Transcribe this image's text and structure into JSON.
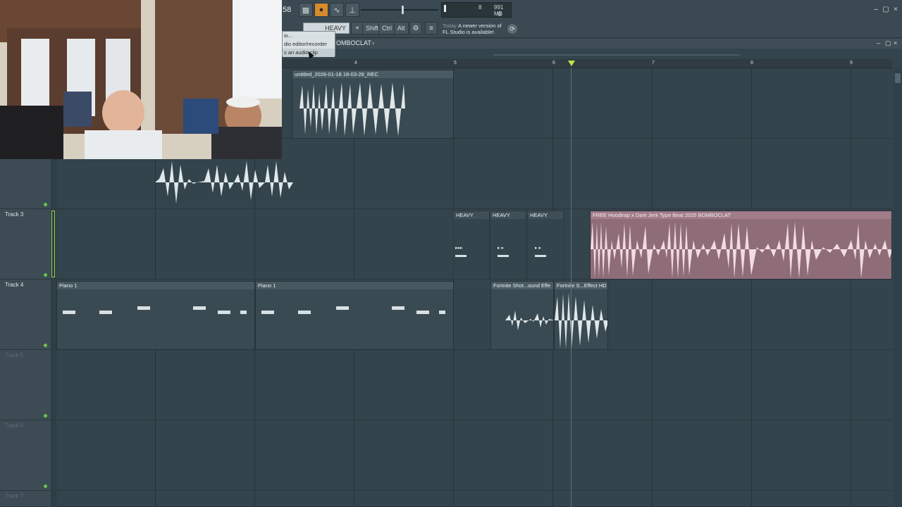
{
  "toolbar": {
    "tempo_fragment": "58",
    "cpu": {
      "value": "8",
      "memory": "991 MB",
      "polyphony": "0"
    },
    "pattern_name": "HEAVY",
    "keys": [
      "Shift",
      "Ctrl",
      "Alt"
    ],
    "news": {
      "today": "Today",
      "line1": "A newer version of",
      "line2": "FL Studio is available!"
    }
  },
  "dropdown": {
    "items": [
      "io...",
      "dio editor/recorder",
      "s an audio clip"
    ]
  },
  "playlist": {
    "title": "OMBOCLAT",
    "ruler_marks": [
      "4",
      "5",
      "6",
      "7",
      "8",
      "9"
    ],
    "tracks": [
      {
        "name": ""
      },
      {
        "name": ""
      },
      {
        "name": "Track 3"
      },
      {
        "name": "Track 4"
      },
      {
        "name": "Track 5"
      },
      {
        "name": "Track 6"
      },
      {
        "name": "Track 7"
      }
    ],
    "clips": {
      "rec": "untitled_2026-01-18 18-03-28_REC",
      "heavy1": "HEAVY",
      "heavy2": "HEAVY",
      "heavy3": "HEAVY",
      "beat": "FREE Hoodtrap x Dark Jerk Type Beat 2025 BOMBOCLAT",
      "piano1": "Piano 1",
      "piano2": "Piano 1",
      "fortnite1": "Fortnite Shot...ound Effe",
      "fortnite2": "Fortnite S...Effect HD"
    }
  },
  "colors": {
    "accent": "#d78b2c",
    "track_led": "#6cc24a",
    "playhead": "#c6e04a",
    "beat_clip": "#a27c88"
  }
}
